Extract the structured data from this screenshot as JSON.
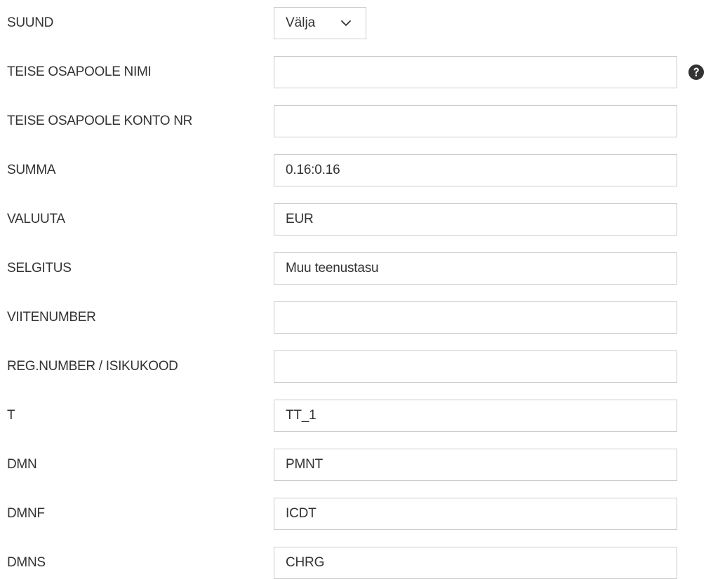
{
  "form": {
    "direction": {
      "label": "SUUND",
      "selected": "Välja"
    },
    "counterparty_name": {
      "label": "TEISE OSAPOOLE NIMI",
      "value": "",
      "help_icon": "question-circle-icon"
    },
    "counterparty_account": {
      "label": "TEISE OSAPOOLE KONTO NR",
      "value": ""
    },
    "amount": {
      "label": "SUMMA",
      "value": "0.16:0.16"
    },
    "currency": {
      "label": "VALUUTA",
      "value": "EUR"
    },
    "description": {
      "label": "SELGITUS",
      "value": "Muu teenustasu"
    },
    "reference_number": {
      "label": "VIITENUMBER",
      "value": ""
    },
    "reg_number": {
      "label": "REG.NUMBER / ISIKUKOOD",
      "value": ""
    },
    "t": {
      "label": "T",
      "value": "TT_1"
    },
    "dmn": {
      "label": "DMN",
      "value": "PMNT"
    },
    "dmnf": {
      "label": "DMNF",
      "value": "ICDT"
    },
    "dmns": {
      "label": "DMNS",
      "value": "CHRG"
    }
  }
}
